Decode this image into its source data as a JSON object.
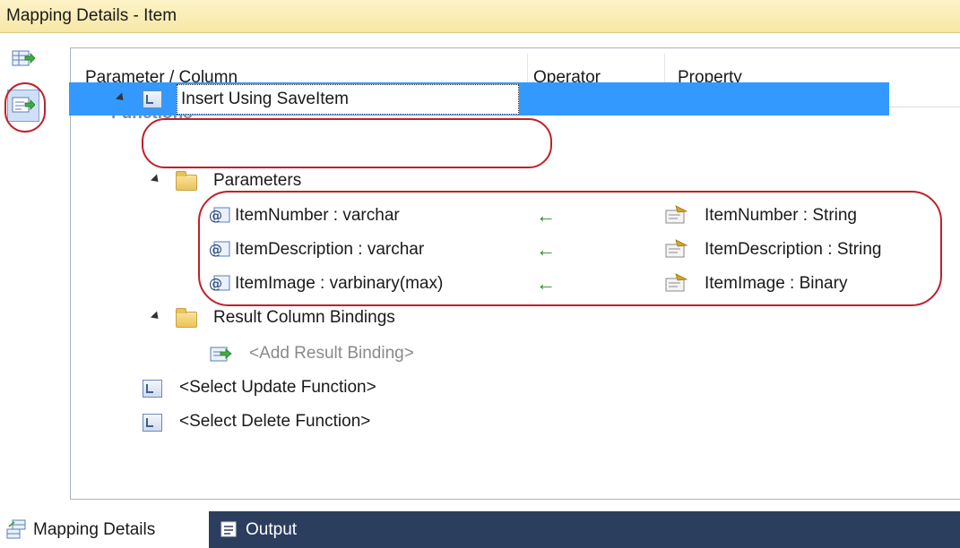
{
  "window": {
    "title": "Mapping Details - Item"
  },
  "columns": {
    "param": "Parameter / Column",
    "operator": "Operator",
    "property": "Property"
  },
  "tree": {
    "functions": "Functions",
    "insert_function": "Insert Using SaveItem",
    "parameters_folder": "Parameters",
    "parameters": [
      {
        "name": "ItemNumber : varchar",
        "operator": "←",
        "property": "ItemNumber : String"
      },
      {
        "name": "ItemDescription : varchar",
        "operator": "←",
        "property": "ItemDescription : String"
      },
      {
        "name": "ItemImage : varbinary(max)",
        "operator": "←",
        "property": "ItemImage : Binary"
      }
    ],
    "result_bindings_folder": "Result Column Bindings",
    "add_result_binding": "<Add Result Binding>",
    "select_update": "<Select Update Function>",
    "select_delete": "<Select Delete Function>"
  },
  "tabs": {
    "mapping_details": "Mapping Details",
    "output": "Output"
  },
  "colors": {
    "selection": "#3399ff",
    "highlight_oval": "#c0202a",
    "arrow": "#2a8a2a",
    "footer": "#2c3e5e"
  },
  "icons": {
    "side_top": "map-entity-table-icon",
    "side_second": "map-entity-functions-icon",
    "function": "function-icon",
    "folder": "folder-icon",
    "parameter": "parameter-icon",
    "property": "property-icon",
    "add_binding": "add-binding-icon"
  }
}
